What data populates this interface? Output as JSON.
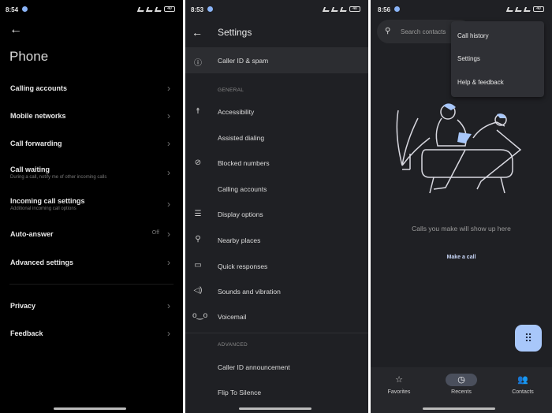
{
  "panel1": {
    "status": {
      "time": "8:54",
      "battery": "40"
    },
    "title": "Phone",
    "items": [
      {
        "label": "Calling accounts",
        "sub": "",
        "value": ""
      },
      {
        "label": "Mobile networks",
        "sub": "",
        "value": ""
      },
      {
        "label": "Call forwarding",
        "sub": "",
        "value": ""
      },
      {
        "label": "Call waiting",
        "sub": "During a call, notify me of other incoming calls",
        "value": ""
      },
      {
        "label": "Incoming call settings",
        "sub": "Additional incoming call options",
        "value": ""
      },
      {
        "label": "Auto-answer",
        "sub": "",
        "value": "Off"
      },
      {
        "label": "Advanced settings",
        "sub": "",
        "value": ""
      },
      {
        "label": "Privacy",
        "sub": "",
        "value": ""
      },
      {
        "label": "Feedback",
        "sub": "",
        "value": ""
      }
    ]
  },
  "panel2": {
    "status": {
      "time": "8:53",
      "battery": "40"
    },
    "title": "Settings",
    "top_item": "Caller ID & spam",
    "section_general": "GENERAL",
    "items": [
      "Accessibility",
      "Assisted dialing",
      "Blocked numbers",
      "Calling accounts",
      "Display options",
      "Nearby places",
      "Quick responses",
      "Sounds and vibration",
      "Voicemail"
    ],
    "section_advanced": "ADVANCED",
    "advanced_items": [
      "Caller ID announcement",
      "Flip To Silence"
    ]
  },
  "panel3": {
    "status": {
      "time": "8:56",
      "battery": "40"
    },
    "search_placeholder": "Search contacts",
    "menu": [
      "Call history",
      "Settings",
      "Help & feedback"
    ],
    "empty_text": "Calls you make will show up here",
    "make_call": "Make a call",
    "nav": [
      "Favorites",
      "Recents",
      "Contacts"
    ],
    "accent": "#a8c7fa"
  }
}
